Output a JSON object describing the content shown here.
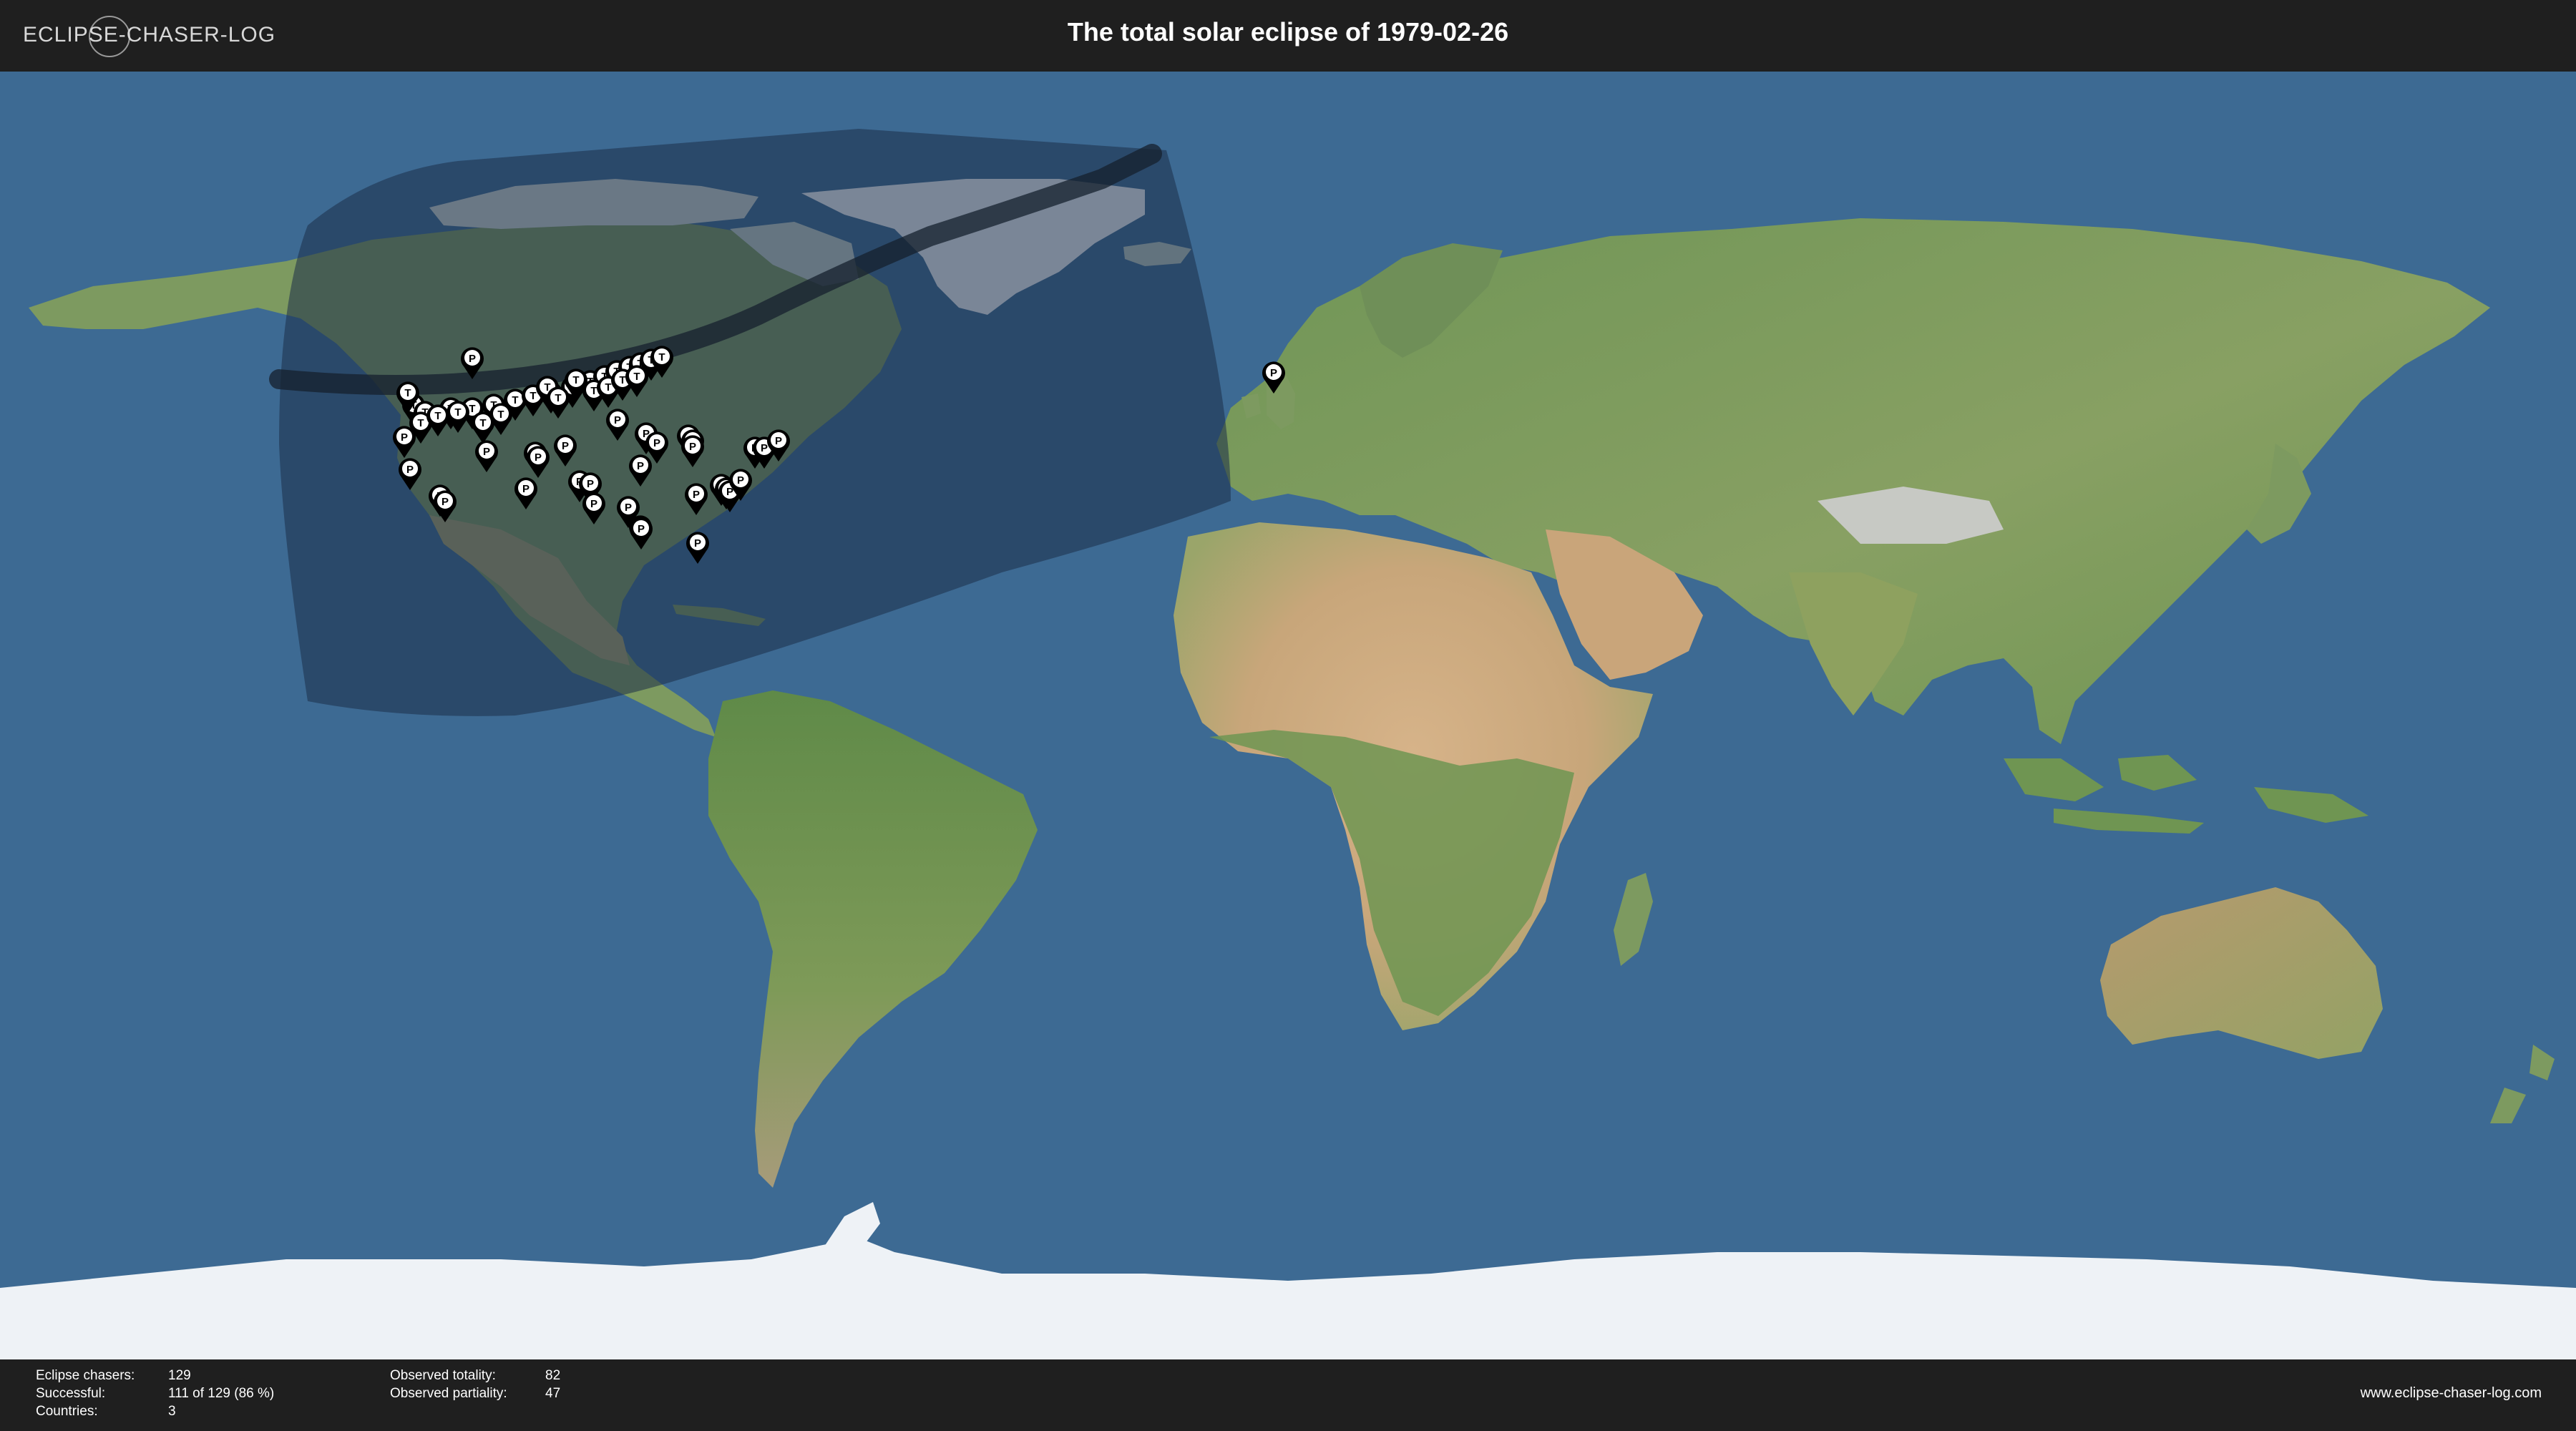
{
  "header": {
    "logo": "ECLIPSE-CHASER-LOG",
    "title": "The total solar eclipse of 1979-02-26"
  },
  "footer": {
    "stats_left": [
      {
        "label": "Eclipse chasers:",
        "value": "129"
      },
      {
        "label": "Successful:",
        "value": "111 of 129 (86 %)"
      },
      {
        "label": "Countries:",
        "value": "3"
      }
    ],
    "stats_right": [
      {
        "label": "Observed totality:",
        "value": "82"
      },
      {
        "label": "Observed partiality:",
        "value": "47"
      }
    ],
    "website": "www.eclipse-chaser-log.com"
  },
  "map": {
    "colors": {
      "ocean": "#3d6a93",
      "land": "#7c9a5e",
      "desert": "#c9a57a",
      "ice": "#eef2f6",
      "penumbra": "#1c2e48",
      "totality_path": "#15202e",
      "marker": "#000000",
      "marker_label_bg": "#ffffff"
    },
    "marker_legend": {
      "P": "partiality",
      "T": "totality"
    }
  }
}
